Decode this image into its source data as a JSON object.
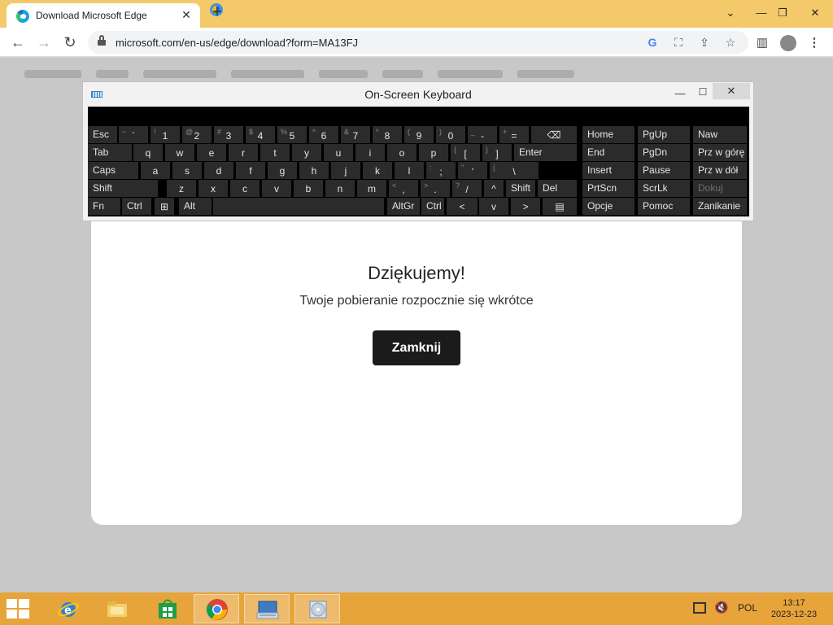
{
  "browser": {
    "tab_title": "Download Microsoft Edge",
    "url": "microsoft.com/en-us/edge/download?form=MA13FJ"
  },
  "dialog": {
    "title": "Dziękujemy!",
    "subtitle": "Twoje pobieranie rozpocznie się wkrótce",
    "close_button": "Zamknij"
  },
  "osk": {
    "title": "On-Screen Keyboard",
    "rows": [
      [
        [
          "Esc",
          ""
        ],
        [
          "`",
          "~"
        ],
        [
          "1",
          "!"
        ],
        [
          "2",
          "@"
        ],
        [
          "3",
          "#"
        ],
        [
          "4",
          "$"
        ],
        [
          "5",
          "%"
        ],
        [
          "6",
          "^"
        ],
        [
          "7",
          "&"
        ],
        [
          "8",
          "*"
        ],
        [
          "9",
          "("
        ],
        [
          "0",
          ")"
        ],
        [
          "-",
          "_"
        ],
        [
          "=",
          "+"
        ],
        [
          "⌫",
          ""
        ]
      ],
      [
        [
          "Tab",
          ""
        ],
        [
          "q",
          ""
        ],
        [
          "w",
          ""
        ],
        [
          "e",
          ""
        ],
        [
          "r",
          ""
        ],
        [
          "t",
          ""
        ],
        [
          "y",
          ""
        ],
        [
          "u",
          ""
        ],
        [
          "i",
          ""
        ],
        [
          "o",
          ""
        ],
        [
          "p",
          ""
        ],
        [
          "[",
          "{"
        ],
        [
          "]",
          "}"
        ],
        [
          "Enter",
          ""
        ]
      ],
      [
        [
          "Caps",
          ""
        ],
        [
          "a",
          ""
        ],
        [
          "s",
          ""
        ],
        [
          "d",
          ""
        ],
        [
          "f",
          ""
        ],
        [
          "g",
          ""
        ],
        [
          "h",
          ""
        ],
        [
          "j",
          ""
        ],
        [
          "k",
          ""
        ],
        [
          "l",
          ""
        ],
        [
          ";",
          ":"
        ],
        [
          "'",
          "\""
        ],
        [
          "\\",
          "|"
        ]
      ],
      [
        [
          "Shift",
          ""
        ],
        [
          "z",
          ""
        ],
        [
          "x",
          ""
        ],
        [
          "c",
          ""
        ],
        [
          "v",
          ""
        ],
        [
          "b",
          ""
        ],
        [
          "n",
          ""
        ],
        [
          "m",
          ""
        ],
        [
          ",",
          "<"
        ],
        [
          ".",
          ">"
        ],
        [
          "/",
          "?"
        ],
        [
          "^",
          ""
        ],
        [
          "Shift",
          ""
        ],
        [
          "Del",
          ""
        ]
      ],
      [
        [
          "Fn",
          ""
        ],
        [
          "Ctrl",
          ""
        ],
        [
          "⊞",
          ""
        ],
        [
          "Alt",
          ""
        ],
        [
          " ",
          ""
        ],
        [
          "AltGr",
          ""
        ],
        [
          "Ctrl",
          ""
        ],
        [
          "<",
          ""
        ],
        [
          "v",
          ""
        ],
        [
          ">",
          ""
        ],
        [
          "▤",
          ""
        ]
      ]
    ],
    "nav_rows": [
      [
        "Home",
        "PgUp",
        "Naw"
      ],
      [
        "End",
        "PgDn",
        "Prz w górę"
      ],
      [
        "Insert",
        "Pause",
        "Prz w dół"
      ],
      [
        "PrtScn",
        "ScrLk",
        "Dokuj"
      ],
      [
        "Opcje",
        "Pomoc",
        "Zanikanie"
      ]
    ]
  },
  "taskbar": {
    "language": "POL",
    "time": "13:17",
    "date": "2023-12-23"
  }
}
